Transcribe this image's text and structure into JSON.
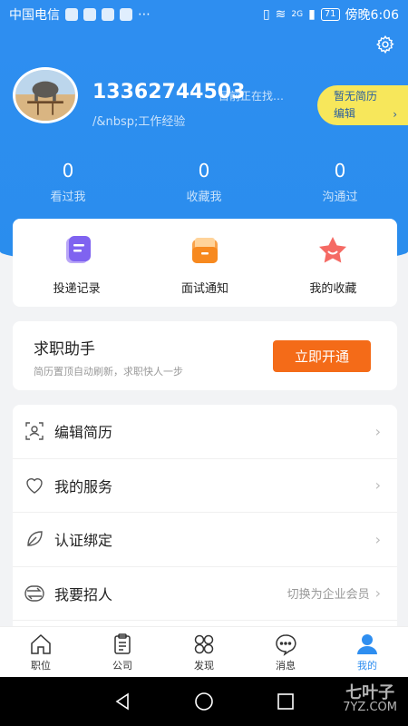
{
  "status_bar": {
    "carrier": "中国电信",
    "network": "2G",
    "battery": "71",
    "time": "傍晚6:06"
  },
  "profile": {
    "phone": "13362744503",
    "seeking_status": "目前正在找…",
    "experience": "/&nbsp;工作经验",
    "resume_line1": "暂无简历",
    "resume_line2": "编辑"
  },
  "stats": [
    {
      "value": "0",
      "label": "看过我"
    },
    {
      "value": "0",
      "label": "收藏我"
    },
    {
      "value": "0",
      "label": "沟通过"
    }
  ],
  "quick_actions": [
    {
      "label": "投递记录",
      "icon": "document-icon"
    },
    {
      "label": "面试通知",
      "icon": "envelope-icon"
    },
    {
      "label": "我的收藏",
      "icon": "star-icon"
    }
  ],
  "job_helper": {
    "title": "求职助手",
    "subtitle": "简历置顶自动刷新，求职快人一步",
    "button": "立即开通"
  },
  "menu": [
    {
      "label": "编辑简历",
      "icon": "resume-icon",
      "hint": ""
    },
    {
      "label": "我的服务",
      "icon": "heart-icon",
      "hint": ""
    },
    {
      "label": "认证绑定",
      "icon": "leaf-icon",
      "hint": ""
    },
    {
      "label": "我要招人",
      "icon": "switch-icon",
      "hint": "切换为企业会员"
    }
  ],
  "tabs": [
    {
      "label": "职位",
      "icon": "home-icon"
    },
    {
      "label": "公司",
      "icon": "clipboard-icon"
    },
    {
      "label": "发现",
      "icon": "discover-icon"
    },
    {
      "label": "消息",
      "icon": "message-icon"
    },
    {
      "label": "我的",
      "icon": "profile-icon"
    }
  ],
  "watermark": {
    "line1": "七叶子",
    "line2": "7YZ.COM"
  },
  "colors": {
    "primary": "#2e8ef0",
    "accent_orange": "#f46b18",
    "resume_pill": "#f7e75b"
  }
}
